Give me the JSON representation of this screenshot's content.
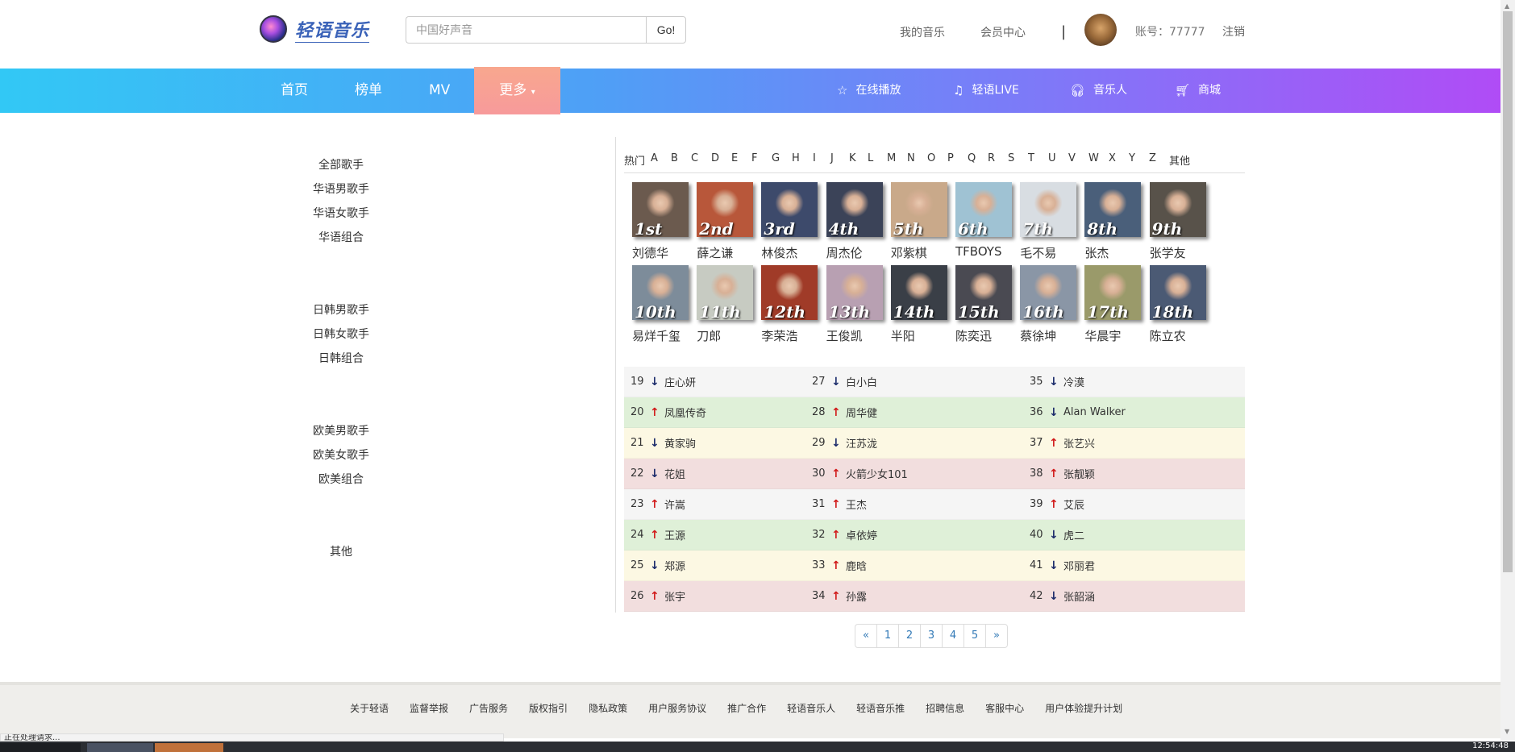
{
  "header": {
    "logo_text": "轻语音乐",
    "search_placeholder": "中国好声音",
    "search_button": "Go!",
    "my_music": "我的音乐",
    "vip_center": "会员中心",
    "separator": "|",
    "account_label": "账号：77777",
    "logout": "注销"
  },
  "nav": {
    "home": "首页",
    "charts": "榜单",
    "mv": "MV",
    "more": "更多",
    "online_play": "在线播放",
    "live": "轻语LIVE",
    "musicians": "音乐人",
    "shop": "商城"
  },
  "sidebar": {
    "groups": [
      [
        "全部歌手",
        "华语男歌手",
        "华语女歌手",
        "华语组合"
      ],
      [
        "日韩男歌手",
        "日韩女歌手",
        "日韩组合"
      ],
      [
        "欧美男歌手",
        "欧美女歌手",
        "欧美组合"
      ],
      [
        "其他"
      ]
    ]
  },
  "alphabet": [
    "热门",
    "A",
    "B",
    "C",
    "D",
    "E",
    "F",
    "G",
    "H",
    "I",
    "J",
    "K",
    "L",
    "M",
    "N",
    "O",
    "P",
    "Q",
    "R",
    "S",
    "T",
    "U",
    "V",
    "W",
    "X",
    "Y",
    "Z",
    "其他"
  ],
  "top_artists": [
    {
      "rank": "1st",
      "name": "刘德华"
    },
    {
      "rank": "2nd",
      "name": "薛之谦"
    },
    {
      "rank": "3rd",
      "name": "林俊杰"
    },
    {
      "rank": "4th",
      "name": "周杰伦"
    },
    {
      "rank": "5th",
      "name": "邓紫棋"
    },
    {
      "rank": "6th",
      "name": "TFBOYS"
    },
    {
      "rank": "7th",
      "name": "毛不易"
    },
    {
      "rank": "8th",
      "name": "张杰"
    },
    {
      "rank": "9th",
      "name": "张学友"
    },
    {
      "rank": "10th",
      "name": "易烊千玺"
    },
    {
      "rank": "11th",
      "name": "刀郎"
    },
    {
      "rank": "12th",
      "name": "李荣浩"
    },
    {
      "rank": "13th",
      "name": "王俊凯"
    },
    {
      "rank": "14th",
      "name": "半阳"
    },
    {
      "rank": "15th",
      "name": "陈奕迅"
    },
    {
      "rank": "16th",
      "name": "蔡徐坤"
    },
    {
      "rank": "17th",
      "name": "华晨宇"
    },
    {
      "rank": "18th",
      "name": "陈立农"
    }
  ],
  "thumb_colors": [
    "#6b5a4e",
    "#b8573a",
    "#3d4a6b",
    "#3b4358",
    "#c9a98a",
    "#9fc2d3",
    "#d8dde2",
    "#4a5f7a",
    "#58524a",
    "#7d8c9a",
    "#c7cbc2",
    "#a03b28",
    "#b8a0b2",
    "#3a3f47",
    "#4a4a52",
    "#8a96a6",
    "#9a9a6a",
    "#4b5a74"
  ],
  "ranking": {
    "rows": [
      {
        "bg": "#f5f5f5",
        "cells": [
          {
            "num": "19",
            "dir": "down",
            "name": "庄心妍"
          },
          {
            "num": "27",
            "dir": "down",
            "name": "白小白"
          },
          {
            "num": "35",
            "dir": "down",
            "name": "冷漠"
          }
        ]
      },
      {
        "bg": "#dff0d8",
        "cells": [
          {
            "num": "20",
            "dir": "up",
            "name": "凤凰传奇"
          },
          {
            "num": "28",
            "dir": "up",
            "name": "周华健"
          },
          {
            "num": "36",
            "dir": "down",
            "name": "Alan Walker"
          }
        ]
      },
      {
        "bg": "#fcf8e3",
        "cells": [
          {
            "num": "21",
            "dir": "down",
            "name": "黄家驹"
          },
          {
            "num": "29",
            "dir": "down",
            "name": "汪苏泷"
          },
          {
            "num": "37",
            "dir": "up",
            "name": "张艺兴"
          }
        ]
      },
      {
        "bg": "#f2dede",
        "cells": [
          {
            "num": "22",
            "dir": "down",
            "name": "花姐"
          },
          {
            "num": "30",
            "dir": "up",
            "name": "火箭少女101"
          },
          {
            "num": "38",
            "dir": "up",
            "name": "张靓颖"
          }
        ]
      },
      {
        "bg": "#f5f5f5",
        "cells": [
          {
            "num": "23",
            "dir": "up",
            "name": "许嵩"
          },
          {
            "num": "31",
            "dir": "up",
            "name": "王杰"
          },
          {
            "num": "39",
            "dir": "up",
            "name": "艾辰"
          }
        ]
      },
      {
        "bg": "#dff0d8",
        "cells": [
          {
            "num": "24",
            "dir": "up",
            "name": "王源"
          },
          {
            "num": "32",
            "dir": "up",
            "name": "卓依婷"
          },
          {
            "num": "40",
            "dir": "down",
            "name": "虎二"
          }
        ]
      },
      {
        "bg": "#fcf8e3",
        "cells": [
          {
            "num": "25",
            "dir": "down",
            "name": "郑源"
          },
          {
            "num": "33",
            "dir": "up",
            "name": "鹿晗"
          },
          {
            "num": "41",
            "dir": "down",
            "name": "邓丽君"
          }
        ]
      },
      {
        "bg": "#f2dede",
        "cells": [
          {
            "num": "26",
            "dir": "up",
            "name": "张宇"
          },
          {
            "num": "34",
            "dir": "up",
            "name": "孙露"
          },
          {
            "num": "42",
            "dir": "down",
            "name": "张韶涵"
          }
        ]
      }
    ]
  },
  "pagination": [
    "«",
    "1",
    "2",
    "3",
    "4",
    "5",
    "»"
  ],
  "footer": [
    "关于轻语",
    "监督举报",
    "广告服务",
    "版权指引",
    "隐私政策",
    "用户服务协议",
    "推广合作",
    "轻语音乐人",
    "轻语音乐推",
    "招聘信息",
    "客服中心",
    "用户体验提升计划"
  ],
  "status_text": "正在处理请求...",
  "clock": "12:54:48",
  "icons": {
    "online_play": "star-icon",
    "live": "music-note-icon",
    "musicians": "headphones-icon",
    "shop": "cart-icon"
  }
}
